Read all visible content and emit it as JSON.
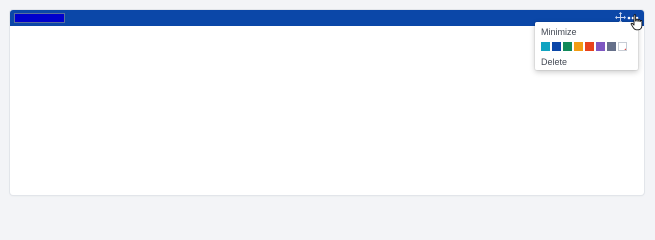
{
  "widget": {
    "header_color": "#0b47a8",
    "title_value": "",
    "title_highlight_color": "#0000cc",
    "toolbar": {
      "move_icon": "move-arrows-icon",
      "more_icon": "more-dots-icon"
    }
  },
  "menu": {
    "minimize_label": "Minimize",
    "delete_label": "Delete",
    "colors": [
      {
        "name": "teal",
        "hex": "#10a3c1"
      },
      {
        "name": "dark-blue",
        "hex": "#0b47a8"
      },
      {
        "name": "green",
        "hex": "#128a5a"
      },
      {
        "name": "orange",
        "hex": "#f39c12"
      },
      {
        "name": "red-orange",
        "hex": "#e8421c"
      },
      {
        "name": "purple",
        "hex": "#7e57c2"
      },
      {
        "name": "slate",
        "hex": "#66708a"
      },
      {
        "name": "no-color",
        "hex": "none"
      }
    ]
  },
  "cursor": {
    "icon": "hand-pointer-icon"
  }
}
